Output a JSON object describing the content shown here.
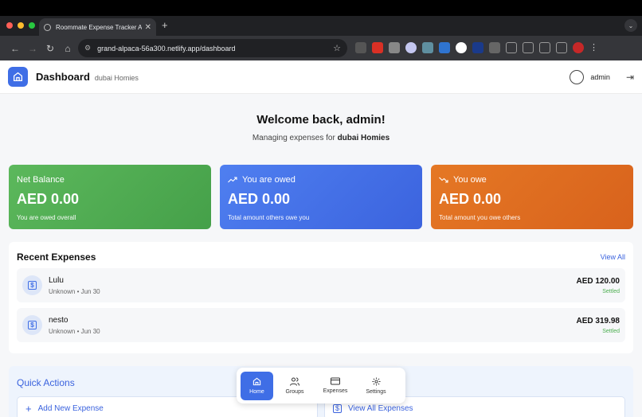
{
  "browser": {
    "tab_title": "Roommate Expense Tracker A",
    "url": "grand-alpaca-56a300.netlify.app/dashboard"
  },
  "header": {
    "title": "Dashboard",
    "subtitle": "dubai Homies",
    "username": "admin"
  },
  "welcome": {
    "heading": "Welcome back, admin!",
    "line_prefix": "Managing expenses for",
    "group": "dubai Homies"
  },
  "cards": [
    {
      "label": "Net Balance",
      "amount": "AED 0.00",
      "desc": "You are owed overall",
      "color": "#4fae4f"
    },
    {
      "label": "You are owed",
      "amount": "AED 0.00",
      "desc": "Total amount others owe you",
      "color": "#4470ea"
    },
    {
      "label": "You owe",
      "amount": "AED 0.00",
      "desc": "Total amount you owe others",
      "color": "#de6c20"
    }
  ],
  "recent": {
    "title": "Recent Expenses",
    "view_all": "View All",
    "items": [
      {
        "name": "Lulu",
        "meta": "Unknown • Jun 30",
        "amount": "AED 120.00",
        "status": "Settled"
      },
      {
        "name": "nesto",
        "meta": "Unknown • Jun 30",
        "amount": "AED 319.98",
        "status": "Settled"
      }
    ]
  },
  "quick": {
    "title": "Quick Actions",
    "add": "Add New Expense",
    "view": "View All Expenses"
  },
  "nav": {
    "home": "Home",
    "groups": "Groups",
    "expenses": "Expenses",
    "settings": "Settings"
  }
}
